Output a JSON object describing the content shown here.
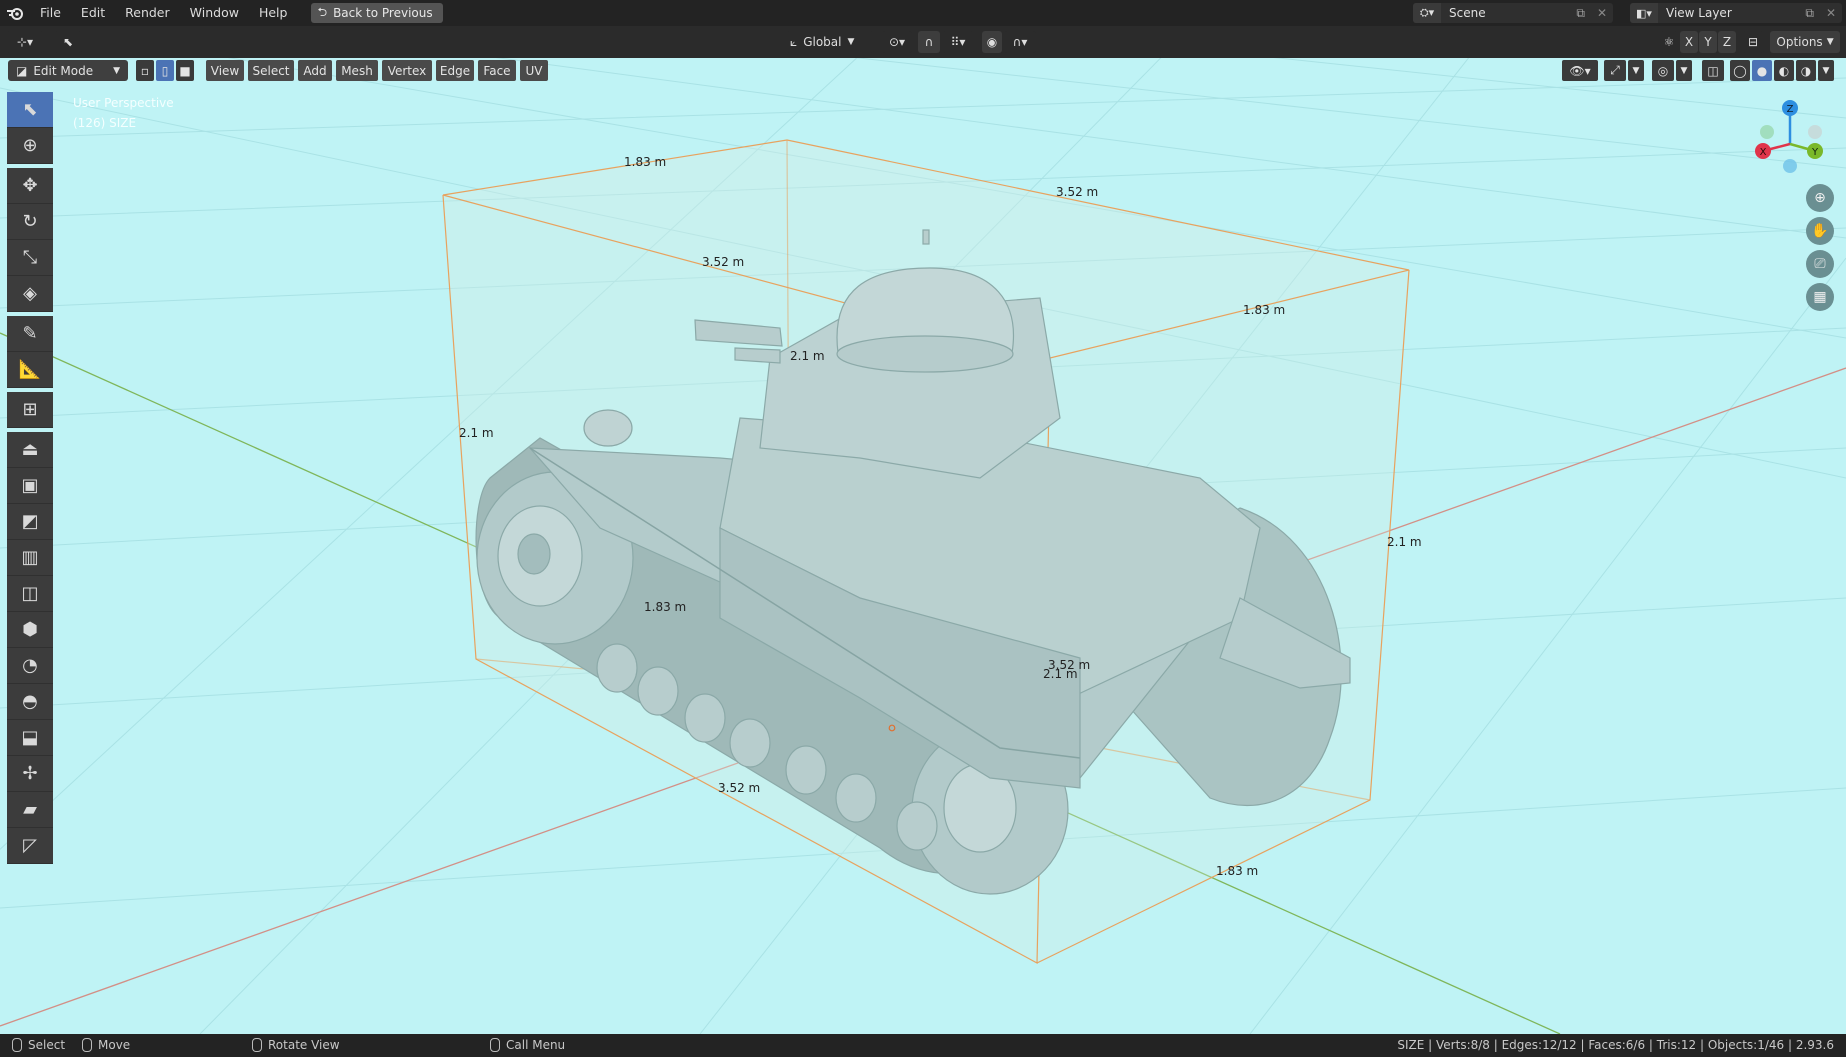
{
  "topbar": {
    "menus": [
      "File",
      "Edit",
      "Render",
      "Window",
      "Help"
    ],
    "back_label": "Back to Previous",
    "scene_label": "Scene",
    "view_layer_label": "View Layer"
  },
  "header2": {
    "transform_orientation": "Global",
    "axes": [
      "X",
      "Y",
      "Z"
    ],
    "options_label": "Options"
  },
  "viewport_header": {
    "mode": "Edit Mode",
    "menus": [
      "View",
      "Select",
      "Add",
      "Mesh",
      "Vertex",
      "Edge",
      "Face",
      "UV"
    ]
  },
  "overlay": {
    "perspective": "User Perspective",
    "object_info": "(126) SIZE"
  },
  "toolbar": {
    "tools": [
      {
        "name": "select-box-tool",
        "icon": "cursor-select-icon",
        "glyph": "⬉",
        "active": true
      },
      {
        "name": "cursor-tool",
        "icon": "crosshair-icon",
        "glyph": "⊕"
      },
      {
        "name": "move-tool",
        "icon": "move-icon",
        "glyph": "✥"
      },
      {
        "name": "rotate-tool",
        "icon": "rotate-icon",
        "glyph": "↻"
      },
      {
        "name": "scale-tool",
        "icon": "scale-icon",
        "glyph": "⤡"
      },
      {
        "name": "transform-tool",
        "icon": "transform-icon",
        "glyph": "◈"
      },
      {
        "name": "annotate-tool",
        "icon": "pencil-icon",
        "glyph": "✎"
      },
      {
        "name": "measure-tool",
        "icon": "ruler-icon",
        "glyph": "📐"
      },
      {
        "name": "add-cube-tool",
        "icon": "add-cube-icon",
        "glyph": "⊞"
      },
      {
        "name": "extrude-tool",
        "icon": "extrude-icon",
        "glyph": "⏏"
      },
      {
        "name": "inset-tool",
        "icon": "inset-icon",
        "glyph": "▣"
      },
      {
        "name": "bevel-tool",
        "icon": "bevel-icon",
        "glyph": "◩"
      },
      {
        "name": "loop-cut-tool",
        "icon": "loop-cut-icon",
        "glyph": "▥"
      },
      {
        "name": "knife-tool",
        "icon": "knife-icon",
        "glyph": "◫"
      },
      {
        "name": "poly-build-tool",
        "icon": "poly-build-icon",
        "glyph": "⬢"
      },
      {
        "name": "spin-tool",
        "icon": "spin-icon",
        "glyph": "◔"
      },
      {
        "name": "smooth-tool",
        "icon": "smooth-icon",
        "glyph": "◓"
      },
      {
        "name": "edge-slide-tool",
        "icon": "edge-slide-icon",
        "glyph": "⬓"
      },
      {
        "name": "shrink-fatten-tool",
        "icon": "shrink-fatten-icon",
        "glyph": "✢"
      },
      {
        "name": "shear-tool",
        "icon": "shear-icon",
        "glyph": "▰"
      },
      {
        "name": "rip-tool",
        "icon": "rip-icon",
        "glyph": "◸"
      }
    ]
  },
  "dimensions": {
    "d1": "1.83 m",
    "d2": "3.52 m",
    "d3": "3.52 m",
    "d4": "1.83 m",
    "d5": "2.1 m",
    "d6": "2.1 m",
    "d7": "2.1 m",
    "d8": "1.83 m",
    "d9": "3.52 m",
    "d10": "2.1 m",
    "d11": "3.52 m",
    "d12": "1.83 m"
  },
  "gizmo": {
    "x": "X",
    "y": "Y",
    "z": "Z"
  },
  "status": {
    "select": "Select",
    "move": "Move",
    "rotate": "Rotate View",
    "call_menu": "Call Menu",
    "stats": "SIZE | Verts:8/8 | Edges:12/12 | Faces:6/6 | Tris:12 | Objects:1/46 | 2.93.6"
  },
  "colors": {
    "viewport_bg": "#bff3f5",
    "active_tool": "#4b73b5",
    "bbox_edge": "#e8a25e",
    "axis_x": "#e0344a",
    "axis_y": "#7ab82a",
    "axis_z": "#2d8ee0"
  }
}
